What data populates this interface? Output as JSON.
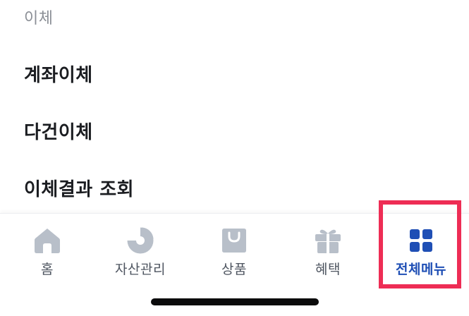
{
  "section": {
    "title": "이체"
  },
  "menu": {
    "items": [
      {
        "label": "계좌이체"
      },
      {
        "label": "다건이체"
      },
      {
        "label": "이체결과 조회"
      }
    ]
  },
  "tabbar": {
    "tabs": [
      {
        "label": "홈",
        "icon": "home-icon"
      },
      {
        "label": "자산관리",
        "icon": "pie-chart-icon"
      },
      {
        "label": "상품",
        "icon": "shopping-bag-icon"
      },
      {
        "label": "혜택",
        "icon": "gift-icon"
      },
      {
        "label": "전체메뉴",
        "icon": "grid-menu-icon",
        "active": true
      }
    ]
  },
  "colors": {
    "inactive_icon": "#b8bfc9",
    "active": "#1f4fb5",
    "highlight": "#ee2d55"
  }
}
